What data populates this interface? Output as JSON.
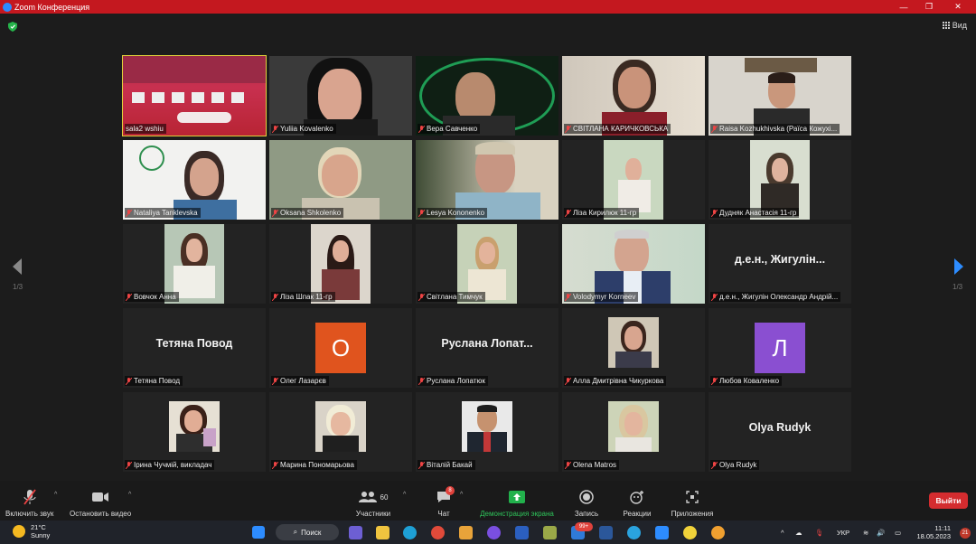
{
  "window": {
    "title": "Zoom Конференция",
    "accent": "#c4181f"
  },
  "view_label": "Вид",
  "pager": {
    "left": "1/3",
    "right": "1/3"
  },
  "participants": [
    {
      "name": "sala2 wshiu",
      "kind": "room",
      "active": true
    },
    {
      "name": "Yuliia Kovalenko",
      "kind": "video"
    },
    {
      "name": "Вера Савченко",
      "kind": "video"
    },
    {
      "name": "СВІТЛАНА КАРИЧКОВСЬКА",
      "kind": "video"
    },
    {
      "name": "Raisa Kozhukhivska (Раїса Кожухі...",
      "kind": "video"
    },
    {
      "name": "Nataliya Tanklevska",
      "kind": "video"
    },
    {
      "name": "Oksana Shkolenko",
      "kind": "video"
    },
    {
      "name": "Lesya Kononenko",
      "kind": "video"
    },
    {
      "name": "Ліза Кирилюк 11-гр",
      "kind": "small"
    },
    {
      "name": "Дудняк Анастасія 11-гр",
      "kind": "small"
    },
    {
      "name": "Вовчок Анна",
      "kind": "small"
    },
    {
      "name": "Ліза Шпак 11-гр",
      "kind": "small"
    },
    {
      "name": "Світлана Тимчук",
      "kind": "small"
    },
    {
      "name": "Volodymyr Korneev",
      "kind": "video"
    },
    {
      "name": "д.е.н., Жигулін Олександр Андрій...",
      "kind": "text",
      "display": "д.е.н., Жигулін..."
    },
    {
      "name": "Тетяна Повод",
      "kind": "text",
      "display": "Тетяна Повод"
    },
    {
      "name": "Олег Лазарєв",
      "kind": "avatar",
      "letter": "О",
      "color": "#e0541e"
    },
    {
      "name": "Руслана Лопатюк",
      "kind": "text",
      "display": "Руслана Лопат..."
    },
    {
      "name": "Алла Дмитрівна Чикуркова",
      "kind": "photo"
    },
    {
      "name": "Любов Коваленко",
      "kind": "avatar",
      "letter": "Л",
      "color": "#8a4fd1"
    },
    {
      "name": "Ірина Чучмій, викладач",
      "kind": "photo"
    },
    {
      "name": "Марина Пономарьова",
      "kind": "photo"
    },
    {
      "name": "Віталій Бакай",
      "kind": "photo"
    },
    {
      "name": "Olena Matros",
      "kind": "photo"
    },
    {
      "name": "Olya Rudyk",
      "kind": "text",
      "display": "Olya Rudyk"
    }
  ],
  "toolbar": {
    "unmute": "Включить звук",
    "start_video": "Остановить видео",
    "participants": "Участники",
    "participants_count": "60",
    "chat": "Чат",
    "chat_badge": "8",
    "share": "Демонстрация экрана",
    "record": "Запись",
    "reactions": "Реакции",
    "apps": "Приложения",
    "leave": "Выйти"
  },
  "taskbar": {
    "temperature": "21°C",
    "weather": "Sunny",
    "search": "Поиск",
    "mail_badge": "99+",
    "language": "УКР",
    "time": "11:11",
    "date": "18.05.2023",
    "notifications": "21"
  }
}
